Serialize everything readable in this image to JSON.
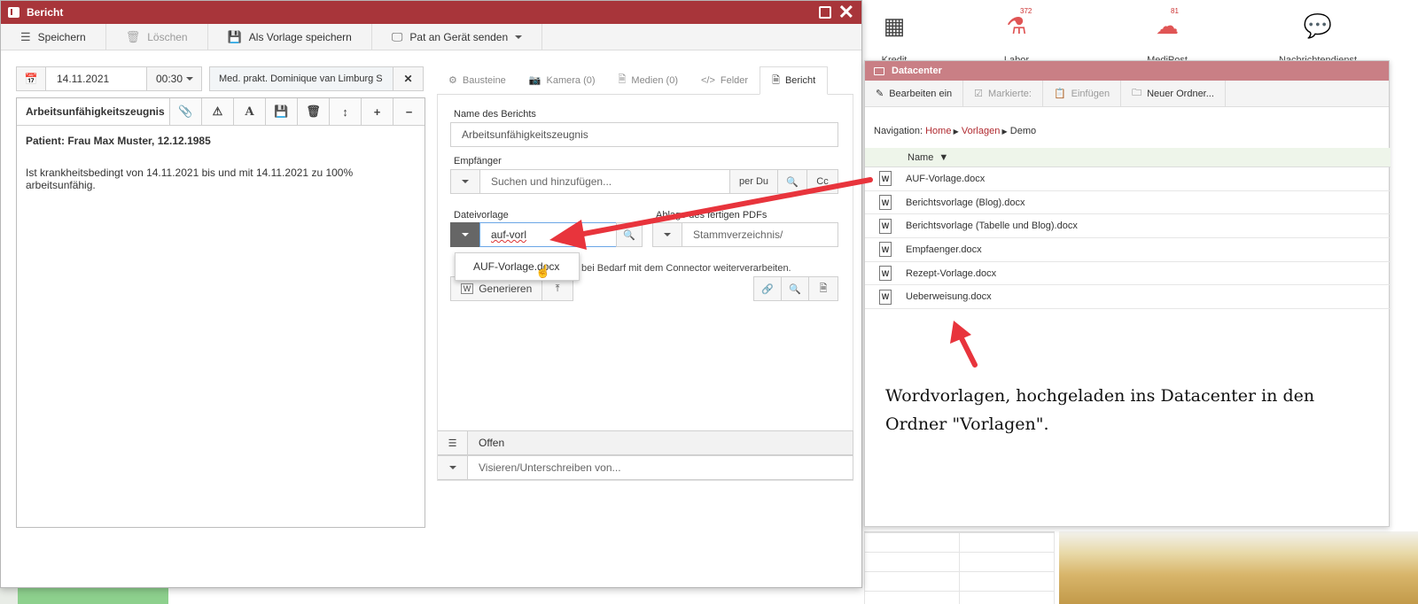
{
  "app_toolbar": {
    "items": [
      {
        "label": "Kredit",
        "icon": "calculator-icon",
        "badge": ""
      },
      {
        "label": "Labor",
        "icon": "flask-icon",
        "badge": "372"
      },
      {
        "label": "MediPost",
        "icon": "medipost-icon",
        "badge": "81"
      },
      {
        "label": "Nachrichtendienst",
        "icon": "chat-icon",
        "badge": ""
      }
    ]
  },
  "bericht": {
    "title": "Bericht",
    "toolbar": {
      "save": "Speichern",
      "delete": "Löschen",
      "save_template": "Als Vorlage speichern",
      "send_device": "Pat an Gerät senden"
    },
    "date": "14.11.2021",
    "time": "00:30",
    "doctor": "Med. prakt. Dominique van Limburg S",
    "editor": {
      "title": "Arbeitsunfähigkeitszeugnis",
      "patient_line": "Patient: Frau Max Muster, 12.12.1985",
      "body": "Ist krankheitsbedingt von 14.11.2021 bis und mit 14.11.2021 zu 100% arbeitsunfähig."
    },
    "tabs": [
      {
        "label": "Bausteine"
      },
      {
        "label": "Kamera (0)"
      },
      {
        "label": "Medien (0)"
      },
      {
        "label": "Felder"
      },
      {
        "label": "Bericht"
      }
    ],
    "form": {
      "name_label": "Name des Berichts",
      "name_value": "Arbeitsunfähigkeitszeugnis",
      "recipient_label": "Empfänger",
      "recipient_placeholder": "Suchen und hinzufügen...",
      "per_du": "per Du",
      "cc": "Cc",
      "template_label": "Dateivorlage",
      "template_value": "auf-vorl",
      "pdf_label": "Ablage des fertigen PDFs",
      "pdf_value": "Stammverzeichnis/",
      "hint": "bei Bedarf mit dem Connector weiterverarbeiten.",
      "generate": "Generieren",
      "status": "Offen",
      "sign_placeholder": "Visieren/Unterschreiben von..."
    },
    "suggestion": "AUF-Vorlage.docx"
  },
  "datacenter": {
    "title": "Datacenter",
    "toolbar": {
      "edit": "Bearbeiten ein",
      "marked": "Markierte:",
      "paste": "Einfügen",
      "new_folder": "Neuer Ordner..."
    },
    "nav_prefix": "Navigation:",
    "nav_home": "Home",
    "nav_templates": "Vorlagen",
    "nav_demo": "Demo",
    "column_name": "Name",
    "files": [
      "AUF-Vorlage.docx",
      "Berichtsvorlage (Blog).docx",
      "Berichtsvorlage (Tabelle und Blog).docx",
      "Empfaenger.docx",
      "Rezept-Vorlage.docx",
      "Ueberweisung.docx"
    ]
  },
  "caption": {
    "line1": "Wordvorlagen, hochgeladen ins Datacenter in den",
    "line2": "Ordner \"Vorlagen\"."
  },
  "colors": {
    "window_title": "#a8353a",
    "datacenter_title": "#c97f85",
    "arrow": "#e8343c",
    "link": "#b02a30"
  }
}
